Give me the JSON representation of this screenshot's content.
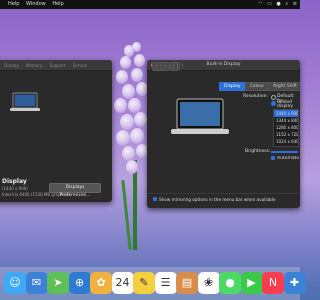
{
  "menubar": {
    "apple": "",
    "items": [
      "Help",
      "Window",
      "Help"
    ],
    "status_icons": [
      "wifi-icon",
      "battery-icon",
      "user-icon",
      "search-icon",
      "menu-icon"
    ]
  },
  "left_window": {
    "tabs": [
      "Display",
      "Memory",
      "Support",
      "Service"
    ],
    "title": "Display",
    "subtitle_1": "(1440 x 900)",
    "subtitle_2": "Intel Iris 6400 (1536 MB graphics)",
    "button_label": "Displays Preferences..."
  },
  "right_window": {
    "title": "Built-in Display",
    "nav_grid_label": "⋮⋮⋮",
    "tabs": [
      "Display",
      "Colour",
      "Night Shift"
    ],
    "active_tab": 0,
    "resolution_label": "Resolution:",
    "resolution_options": [
      "Default for display",
      "Scaled"
    ],
    "resolution_selected": 1,
    "scaled_list": [
      "1440 x 900",
      "1344 x 840",
      "1280 x 800",
      "1152 x 720",
      "1024 x 640"
    ],
    "scaled_selected": 0,
    "brightness_label": "Brightness:",
    "auto_brightness_label": "Automatically adjust brightness",
    "mirroring_label": "Show mirroring options in the menu bar when available"
  },
  "dock": {
    "icons": [
      {
        "name": "finder-icon",
        "glyph": "☺",
        "color": "#3fa9f5"
      },
      {
        "name": "mail-icon",
        "glyph": "✉",
        "color": "#3b82d6"
      },
      {
        "name": "maps-icon",
        "glyph": "➤",
        "color": "#5fbf57"
      },
      {
        "name": "safari-icon",
        "glyph": "⊕",
        "color": "#2d7bd2"
      },
      {
        "name": "photos-icon",
        "glyph": "✿",
        "color": "#f0b23f"
      },
      {
        "name": "calendar-icon",
        "glyph": "24",
        "color": "#ffffff"
      },
      {
        "name": "notes-icon",
        "glyph": "✎",
        "color": "#f4d03f"
      },
      {
        "name": "reminders-icon",
        "glyph": "☰",
        "color": "#ffffff"
      },
      {
        "name": "preview-icon",
        "glyph": "▤",
        "color": "#d88d4a"
      },
      {
        "name": "photos-wheel-icon",
        "glyph": "❀",
        "color": "#ffffff"
      },
      {
        "name": "messages-icon",
        "glyph": "●",
        "color": "#4cd964"
      },
      {
        "name": "facetime-icon",
        "glyph": "▶",
        "color": "#3cc84b"
      },
      {
        "name": "news-icon",
        "glyph": "N",
        "color": "#ff3b4f"
      },
      {
        "name": "app-icon",
        "glyph": "✚",
        "color": "#3b82d6"
      }
    ]
  }
}
